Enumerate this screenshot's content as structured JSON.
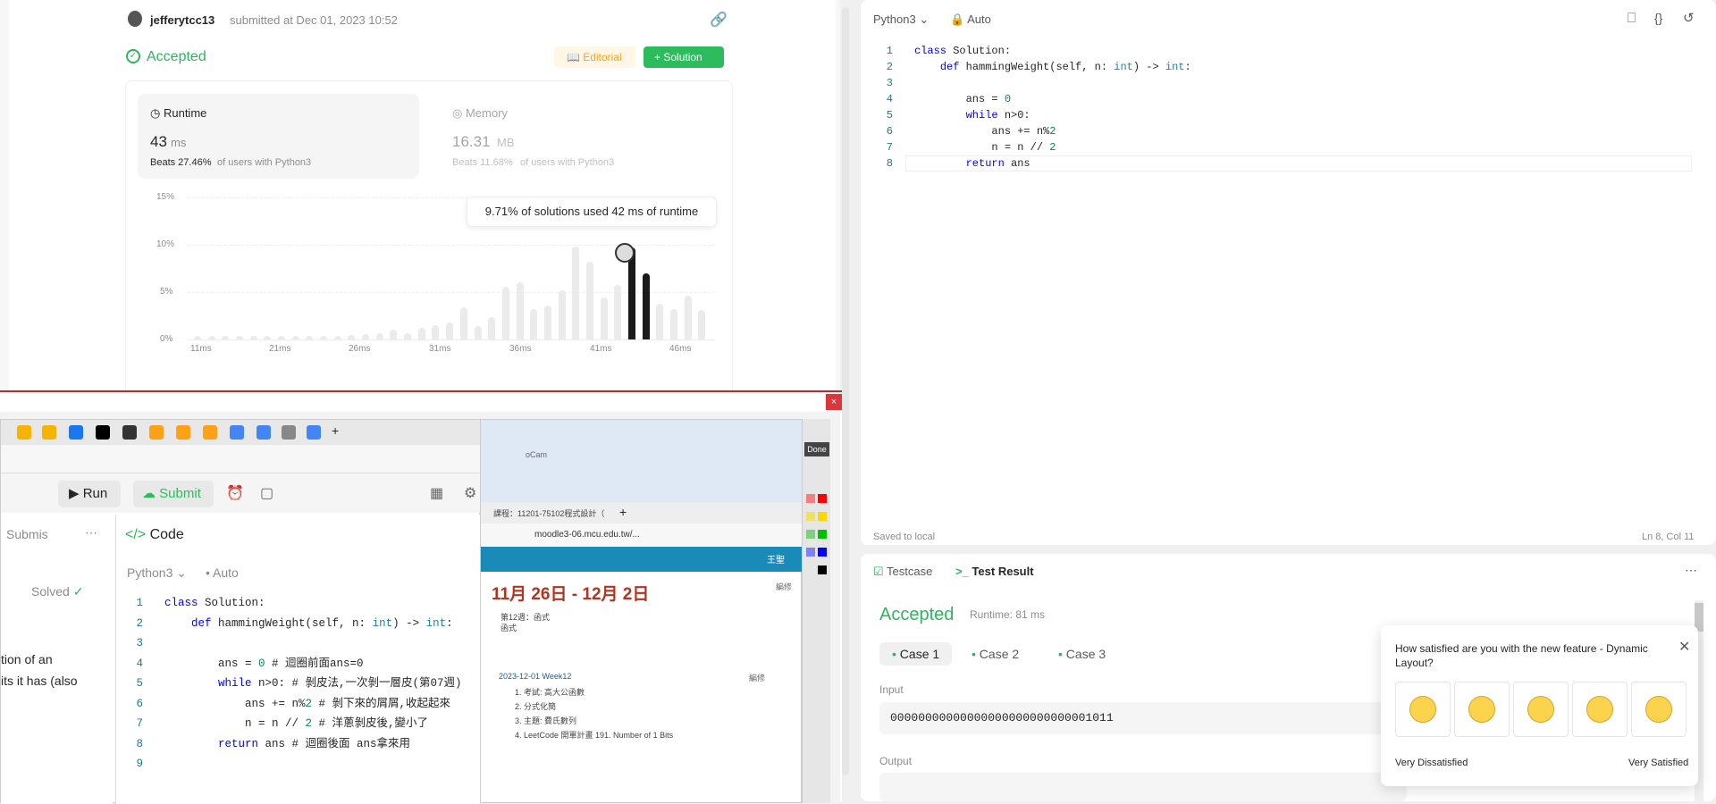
{
  "submission": {
    "user": "jefferytcc13",
    "submitted_text": "submitted at Dec 01, 2023 10:52",
    "status": "Accepted",
    "editorial_label": "Editorial",
    "solution_label": "Solution",
    "runtime": {
      "label": "Runtime",
      "value": "43",
      "unit": "ms",
      "beats": "Beats 27.46%",
      "beats_suffix": "of users with Python3"
    },
    "memory": {
      "label": "Memory",
      "value": "16.31",
      "unit": "MB",
      "beats": "Beats 11.68%",
      "beats_suffix": "of users with Python3"
    },
    "tooltip": "9.71% of solutions used 42 ms of runtime"
  },
  "chart_data": {
    "type": "bar",
    "title": "",
    "xlabel": "",
    "ylabel": "",
    "x_ticks": [
      "11ms",
      "21ms",
      "26ms",
      "31ms",
      "36ms",
      "41ms",
      "46ms"
    ],
    "y_ticks": [
      "15%",
      "10%",
      "5%",
      "0%"
    ],
    "ylim": [
      0,
      15
    ],
    "values": [
      0.4,
      0.4,
      0.4,
      0.4,
      0.4,
      0.4,
      0.4,
      0.4,
      0.4,
      0.4,
      0.4,
      0.5,
      0.6,
      0.7,
      1.0,
      0.7,
      1.2,
      1.5,
      1.8,
      3.4,
      1.4,
      2.4,
      5.6,
      6.0,
      3.2,
      3.6,
      5.2,
      9.8,
      8.2,
      4.4,
      5.8,
      9.71,
      7.0,
      3.8,
      3.2,
      4.6,
      3.1
    ],
    "highlight_indices": [
      31,
      32
    ]
  },
  "editor": {
    "language": "Python3",
    "mode": "Auto",
    "saved": "Saved to local",
    "cursor": "Ln 8, Col 11",
    "lines": [
      "class Solution:",
      "    def hammingWeight(self, n: int) -> int:",
      "",
      "        ans = 0",
      "        while n>0:",
      "            ans += n%2",
      "            n = n // 2",
      "        return ans"
    ]
  },
  "result": {
    "tab_testcase": "Testcase",
    "tab_result": "Test Result",
    "status": "Accepted",
    "runtime": "Runtime: 81 ms",
    "cases": [
      "Case 1",
      "Case 2",
      "Case 3"
    ],
    "input_label": "Input",
    "input_value": "00000000000000000000000000001011",
    "output_label": "Output"
  },
  "survey": {
    "question": "How satisfied are you with the new feature - Dynamic Layout?",
    "low_label": "Very Dissatisfied",
    "high_label": "Very Satisfied"
  },
  "overlay": {
    "run_label": "Run",
    "submit_label": "Submit",
    "submissions_tab": "Submis",
    "code_tab": "Code",
    "language": "Python3",
    "mode": "Auto",
    "solved": "Solved",
    "desc_line1": "tion of an",
    "desc_line2": "its it has (also",
    "code_lines": [
      "class Solution:",
      "    def hammingWeight(self, n: int) -> int:",
      "",
      "        ans = 0 # 迴圈前面ans=0",
      "        while n>0: # 剝皮法,一次剝一層皮(第07週)",
      "            ans += n%2 # 剝下來的屑屑,收起起來",
      "            n = n // 2 # 洋蔥剝皮後,變小了",
      "        return ans # 迴圈後面 ans拿來用",
      ""
    ],
    "ocam": "oCam",
    "moodle_tab": "課程：11201-75102程式設計（",
    "moodle_url": "moodle3-06.mcu.edu.tw/...",
    "date_heading": "11月 26日 - 12月 2日",
    "week_label": "第12週：函式",
    "week_sub": "函式",
    "edit_label": "編修",
    "week_item": "2023-12-01 Week12",
    "items": [
      "1. 考試: 高大公函數",
      "2. 分式化簡",
      "3. 主題: 費氏數列",
      "4. LeetCode 開單計畫 191. Number of 1 Bits"
    ],
    "done": "Done",
    "user_short": "王聖"
  }
}
